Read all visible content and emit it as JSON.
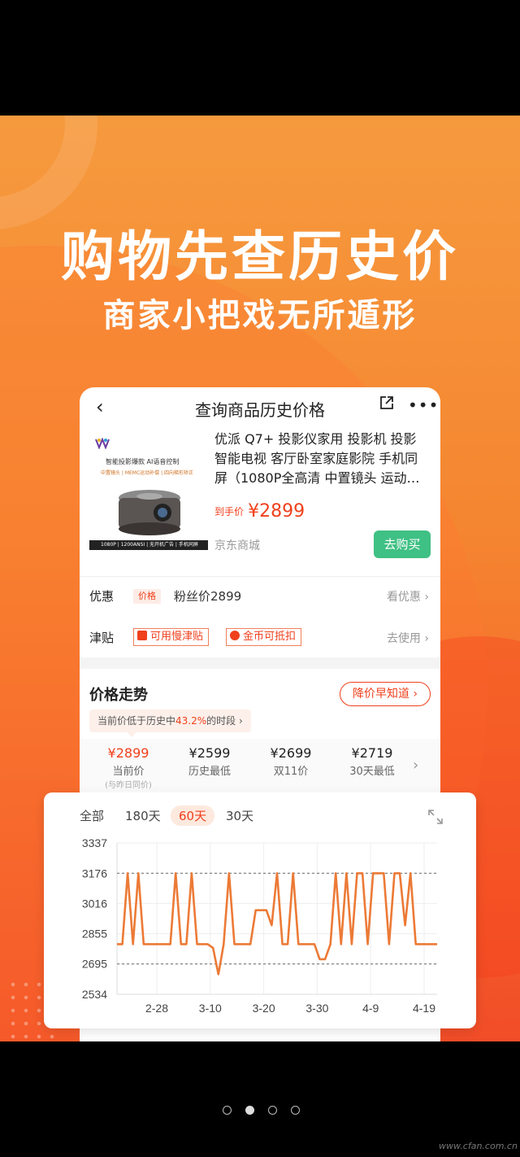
{
  "hero": {
    "title": "购物先查历史价",
    "subtitle": "商家小把戏无所遁形"
  },
  "nav": {
    "back_icon": "‹",
    "title": "查询商品历史价格",
    "more_icon": "•••"
  },
  "product": {
    "image_logo": "ViewSonic",
    "image_headline": "智能投影爆款 AI语音控制",
    "image_features": "中置镜头 | MEMC运动补偿 | 四向梯形矫正",
    "image_strip": "1080P | 1200ANSI | 无开机广告 | 手机同屏",
    "name": "优派 Q7+ 投影仪家用 投影机 投影智能电视 客厅卧室家庭影院 手机同屏（1080P全高清 中置镜头 运动…",
    "price_label": "到手价",
    "price": "¥2899",
    "store": "京东商城",
    "buy_label": "去购买"
  },
  "promo_row": {
    "label": "优惠",
    "tag": "价格",
    "text": "粉丝价2899",
    "link": "看优惠 ›"
  },
  "subsidy_row": {
    "label": "津贴",
    "coupon1": "可用慢津贴",
    "coupon2": "金币可抵扣",
    "link": "去使用 ›"
  },
  "trend": {
    "title": "价格走势",
    "notify_label": "降价早知道 ›",
    "hint_prefix": "当前价低于历史中",
    "hint_pct": "43.2%",
    "hint_suffix": "的时段 ›"
  },
  "stats": [
    {
      "value": "¥2899",
      "label": "当前价",
      "sub": "(与昨日同价)"
    },
    {
      "value": "¥2599",
      "label": "历史最低",
      "sub": ""
    },
    {
      "value": "¥2699",
      "label": "双11价",
      "sub": ""
    },
    {
      "value": "¥2719",
      "label": "30天最低",
      "sub": ""
    }
  ],
  "range_tabs": [
    "全部",
    "180天",
    "60天",
    "30天"
  ],
  "range_active": "60天",
  "chart_data": {
    "type": "line",
    "y_ticks": [
      "3337",
      "3176",
      "3016",
      "2855",
      "2695",
      "2534"
    ],
    "x_ticks": [
      "2-28",
      "3-10",
      "3-20",
      "3-30",
      "4-9",
      "4-19"
    ],
    "ylim": [
      2534,
      3337
    ],
    "reference_lines": [
      3176,
      2695
    ],
    "line_color": "#ec7a36",
    "series": [
      {
        "values": [
          2800,
          2800,
          3176,
          2800,
          3176,
          2800,
          2800,
          2800,
          2800,
          2800,
          2800,
          3176,
          2800,
          2800,
          3176,
          2800,
          2800,
          2800,
          2780,
          2640,
          2800,
          3176,
          2800,
          2800,
          2800,
          2800,
          2980,
          2980,
          2980,
          2900,
          3176,
          2800,
          2800,
          3176,
          2800,
          2800,
          2800,
          2800,
          2720,
          2720,
          2800,
          3176,
          2800,
          3176,
          2800,
          3176,
          3176,
          2800,
          3176,
          3176,
          3176,
          2800,
          3176,
          3176,
          2900,
          3176,
          2800,
          2800,
          2800,
          2800,
          2800
        ]
      }
    ]
  },
  "pagination": {
    "count": 4,
    "active": 1
  },
  "watermark": "www.cfan.com.cn",
  "colors": {
    "accent": "#f0401c",
    "buy": "#3fc084",
    "promo_top": "#f69a3e",
    "promo_bottom": "#f24d28"
  }
}
